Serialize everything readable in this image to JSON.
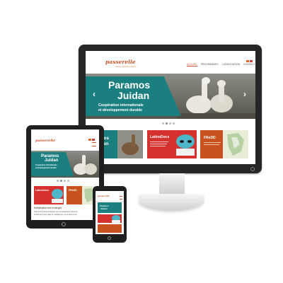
{
  "site": {
    "logo_text": "passerelle",
    "logo_sub": "france amérique latine",
    "nav": [
      "ACCUEIL",
      "PROGRAMMES",
      "L'ASSOCIATION",
      "CONTACT"
    ],
    "hero_title_1": "Paramos",
    "hero_title_2": "Juidan",
    "hero_subtitle_1": "Coopération internationale",
    "hero_subtitle_2": "et développement durable",
    "slider_dots": 4,
    "slider_active_dot": 2,
    "cards": [
      {
        "title": "amos",
        "title_2": "idan",
        "color": "#1b7f80"
      },
      {
        "title": "LatinoDocs",
        "color": "#d4312f"
      },
      {
        "title": "FReDD",
        "color": "#c8531e"
      }
    ],
    "mobile_section_title": "Multiplication des échanges",
    "mobile_section_text_1": "Passerelle France Amérique est une association à but non",
    "mobile_section_text_2": "lucratif qui a pour objet de multiplier les connexions et les"
  },
  "colors": {
    "teal": "#1b7f80",
    "red": "#d4312f",
    "orange": "#c8531e",
    "brand": "#c8522a"
  }
}
